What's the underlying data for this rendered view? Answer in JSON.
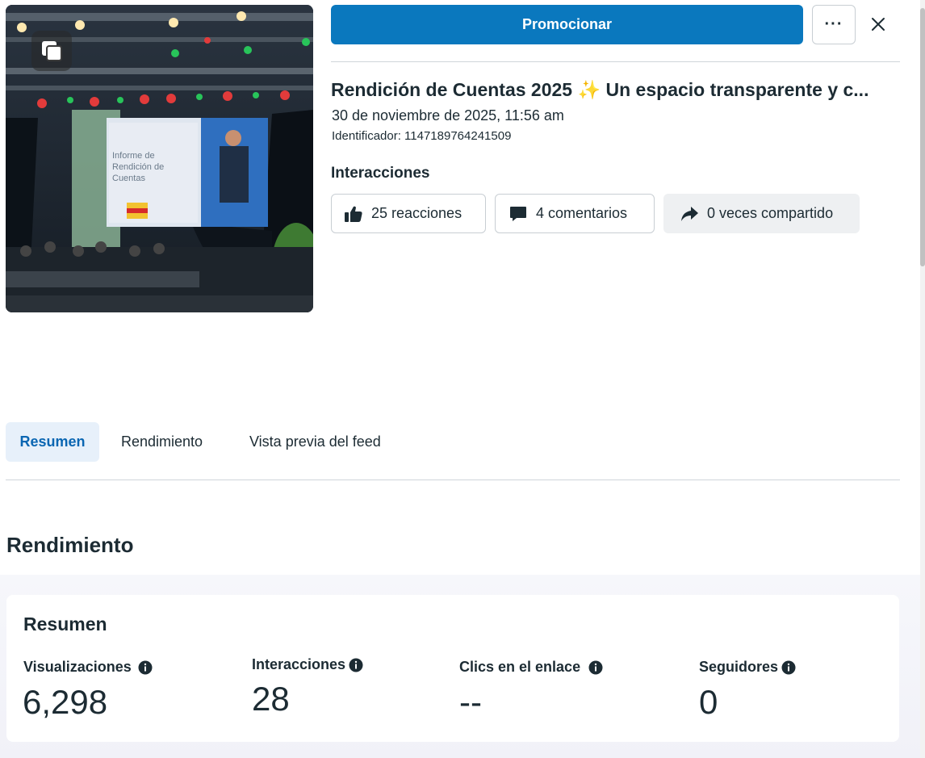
{
  "header": {
    "promote_label": "Promocionar",
    "more_label": "···"
  },
  "post": {
    "title": "Rendición de Cuentas 2025 ✨ Un espacio transparente y c...",
    "date": "30 de noviembre de 2025, 11:56 am",
    "identifier": "Identificador: 1147189764241509",
    "media_icon": "multiple-photos-icon",
    "image_screen_text": "Informe de Rendición de Cuentas"
  },
  "interactions": {
    "heading": "Interacciones",
    "reactions": "25 reacciones",
    "comments": "4 comentarios",
    "shares": "0 veces compartido"
  },
  "tabs": [
    {
      "label": "Resumen",
      "active": true
    },
    {
      "label": "Rendimiento",
      "active": false
    },
    {
      "label": "Vista previa del feed",
      "active": false
    }
  ],
  "performance": {
    "heading": "Rendimiento",
    "card_title": "Resumen",
    "metrics": [
      {
        "label": "Visualizaciones",
        "value": "6,298"
      },
      {
        "label": "Interacciones",
        "value": "28"
      },
      {
        "label": "Clics en el enlace",
        "value": "--"
      },
      {
        "label": "Seguidores",
        "value": "0"
      }
    ]
  },
  "colors": {
    "primary": "#0a78be",
    "active_tab_bg": "#e7f0fa",
    "active_tab_text": "#0a66b2",
    "text": "#1c2b33"
  }
}
